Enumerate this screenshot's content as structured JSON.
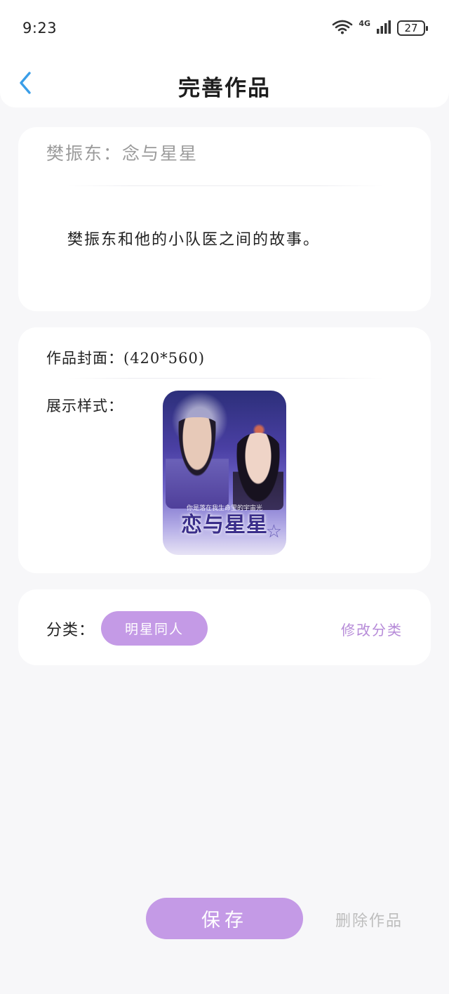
{
  "status_bar": {
    "time": "9:23",
    "network": "4G",
    "battery": "27",
    "icons": [
      "wifi-icon",
      "signal-icon",
      "battery-icon"
    ]
  },
  "header": {
    "title": "完善作品",
    "back_icon": "chevron-left-icon",
    "accent_color": "#3a9ee8"
  },
  "work": {
    "title": "樊振东：念与星星",
    "description": "樊振东和他的小队医之间的故事。"
  },
  "cover": {
    "label": "作品封面：(420*560)",
    "style_label": "展示样式：",
    "image_title": "恋与星星",
    "image_tagline": "你是落在我生命里的宇宙光"
  },
  "category": {
    "label": "分类：",
    "selected": "明星同人",
    "edit_label": "修改分类",
    "chip_color": "#c49ae6"
  },
  "actions": {
    "save_label": "保存",
    "delete_label": "删除作品"
  }
}
